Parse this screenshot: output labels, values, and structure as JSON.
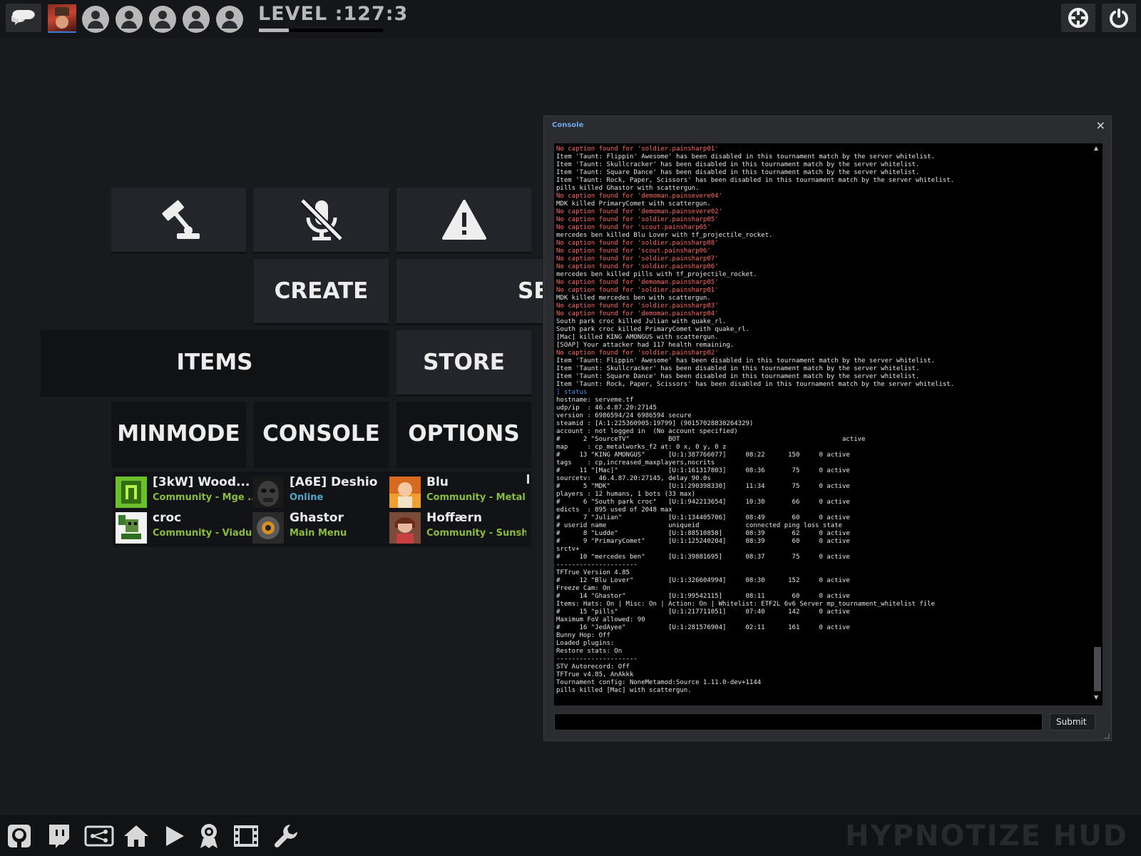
{
  "topbar": {
    "level_label": "LEVEL :127:3",
    "level_progress": 0.24,
    "party_slots": 5
  },
  "menu": {
    "create": "CREATE",
    "servers_partial": "SE",
    "items": "ITEMS",
    "store": "STORE",
    "minmode": "MINMODE",
    "console": "CONSOLE",
    "options": "OPTIONS",
    "icons": [
      "gavel-icon",
      "mic-off-icon",
      "warning-icon"
    ]
  },
  "friends": [
    {
      "name": "[3kW] Wood...",
      "status": "Community - Mge ...",
      "status_type": "community",
      "avatar": "green-block-avatar"
    },
    {
      "name": "[A6E] Deshio",
      "status": "Online",
      "status_type": "online",
      "avatar": "masked-avatar"
    },
    {
      "name": "Blu",
      "status": "Community - Metal...",
      "status_type": "community",
      "avatar": "fire-avatar"
    },
    {
      "name": "croc",
      "status": "Community - Viaduct",
      "status_type": "community",
      "avatar": "pixel-avatar"
    },
    {
      "name": "Ghastor",
      "status": "Main Menu",
      "status_type": "menu",
      "avatar": "robot-avatar"
    },
    {
      "name": "Hoffærn",
      "status": "Community - Sunsh...",
      "status_type": "community",
      "avatar": "girl-avatar"
    }
  ],
  "console": {
    "title": "Console",
    "close": "×",
    "submit": "Submit",
    "input_value": "",
    "lines": [
      {
        "t": "No caption found for 'soldier.painsharp01'",
        "c": "red"
      },
      {
        "t": "Item 'Taunt: Flippin' Awesome' has been disabled in this tournament match by the server whitelist.",
        "c": ""
      },
      {
        "t": "Item 'Taunt: Skullcracker' has been disabled in this tournament match by the server whitelist.",
        "c": ""
      },
      {
        "t": "Item 'Taunt: Square Dance' has been disabled in this tournament match by the server whitelist.",
        "c": ""
      },
      {
        "t": "Item 'Taunt: Rock, Paper, Scissors' has been disabled in this tournament match by the server whitelist.",
        "c": ""
      },
      {
        "t": "pills killed Ghastor with scattergun.",
        "c": ""
      },
      {
        "t": "No caption found for 'demoman.painsevere04'",
        "c": "red"
      },
      {
        "t": "MDK killed PrimaryComet with scattergun.",
        "c": ""
      },
      {
        "t": "No caption found for 'demoman.painsevere02'",
        "c": "red"
      },
      {
        "t": "No caption found for 'soldier.painsharp05'",
        "c": "red"
      },
      {
        "t": "No caption found for 'scout.painsharp05'",
        "c": "red"
      },
      {
        "t": "mercedes ben killed Blu Lover with tf_projectile_rocket.",
        "c": ""
      },
      {
        "t": "No caption found for 'soldier.painsharp08'",
        "c": "red"
      },
      {
        "t": "No caption found for 'scout.painsharp06'",
        "c": "red"
      },
      {
        "t": "No caption found for 'soldier.painsharp07'",
        "c": "red"
      },
      {
        "t": "No caption found for 'soldier.painsharp06'",
        "c": "red"
      },
      {
        "t": "mercedes ben killed pills with tf_projectile_rocket.",
        "c": ""
      },
      {
        "t": "No caption found for 'demoman.painsharp05'",
        "c": "red"
      },
      {
        "t": "No caption found for 'soldier.painsharp01'",
        "c": "red"
      },
      {
        "t": "MDK killed mercedes ben with scattergun.",
        "c": ""
      },
      {
        "t": "No caption found for 'soldier.painsharp03'",
        "c": "red"
      },
      {
        "t": "No caption found for 'demoman.painsharp04'",
        "c": "red"
      },
      {
        "t": "South park croc killed Julian with quake_rl.",
        "c": ""
      },
      {
        "t": "South park croc killed PrimaryComet with quake_rl.",
        "c": ""
      },
      {
        "t": "[Mac] killed KING AMONGUS with scattergun.",
        "c": ""
      },
      {
        "t": "[SOAP] Your attacker had 117 health remaining.",
        "c": ""
      },
      {
        "t": "No caption found for 'soldier.painsharp02'",
        "c": "red"
      },
      {
        "t": "Item 'Taunt: Flippin' Awesome' has been disabled in this tournament match by the server whitelist.",
        "c": ""
      },
      {
        "t": "Item 'Taunt: Skullcracker' has been disabled in this tournament match by the server whitelist.",
        "c": ""
      },
      {
        "t": "Item 'Taunt: Square Dance' has been disabled in this tournament match by the server whitelist.",
        "c": ""
      },
      {
        "t": "Item 'Taunt: Rock, Paper, Scissors' has been disabled in this tournament match by the server whitelist.",
        "c": ""
      },
      {
        "t": "] status",
        "c": "blue"
      },
      {
        "t": "hostname: serveme.tf",
        "c": ""
      },
      {
        "t": "udp/ip  : 46.4.87.20:27145",
        "c": ""
      },
      {
        "t": "version : 6986594/24 6986594 secure",
        "c": ""
      },
      {
        "t": "steamid : [A:1:225360905:19799] (90157028830264329)",
        "c": ""
      },
      {
        "t": "account : not logged in  (No account specified)",
        "c": ""
      },
      {
        "t": "#      2 \"SourceTV\"          BOT                                          active",
        "c": ""
      },
      {
        "t": "map     : cp_metalworks_f2 at: 0 x, 0 y, 0 z",
        "c": ""
      },
      {
        "t": "#     13 \"KING AMONGUS\"      [U:1:387766077]     08:22      150     0 active",
        "c": ""
      },
      {
        "t": "tags    : cp,increased_maxplayers,nocrits",
        "c": ""
      },
      {
        "t": "#     11 \"[Mac]\"             [U:1:161317803]     08:36       75     0 active",
        "c": ""
      },
      {
        "t": "sourcetv:  46.4.87.20:27145, delay 90.0s",
        "c": ""
      },
      {
        "t": "#      5 \"MDK\"               [U:1:290398330]     11:34       75     0 active",
        "c": ""
      },
      {
        "t": "players : 12 humans, 1 bots (33 max)",
        "c": ""
      },
      {
        "t": "#      6 \"South park croc\"   [U:1:942213654]     10:30       66     0 active",
        "c": ""
      },
      {
        "t": "edicts  : 895 used of 2048 max",
        "c": ""
      },
      {
        "t": "#      7 \"Julian\"            [U:1:134405706]     08:49       60     0 active",
        "c": ""
      },
      {
        "t": "# userid name                uniqueid            connected ping loss state",
        "c": ""
      },
      {
        "t": "#      8 \"Ludde\"             [U:1:88510858]      08:39       62     0 active",
        "c": ""
      },
      {
        "t": "#      9 \"PrimaryComet\"      [U:1:125240204]     08:39       60     0 active",
        "c": ""
      },
      {
        "t": "srctv+",
        "c": ""
      },
      {
        "t": "#     10 \"mercedes ben\"      [U:1:39881695]      08:37       75     0 active",
        "c": ""
      },
      {
        "t": "---------------------",
        "c": ""
      },
      {
        "t": "TFTrue Version 4.85",
        "c": ""
      },
      {
        "t": "#     12 \"Blu Lover\"         [U:1:326604994]     08:30      152     0 active",
        "c": ""
      },
      {
        "t": "Freeze Cam: On",
        "c": ""
      },
      {
        "t": "#     14 \"Ghastor\"           [U:1:99542115]      08:11       60     0 active",
        "c": ""
      },
      {
        "t": "Items: Hats: On | Misc: On | Action: On | Whitelist: ETF2L 6v6 Server mp_tournament_whitelist file",
        "c": ""
      },
      {
        "t": "#     15 \"pills\"             [U:1:217711051]     07:40      142     0 active",
        "c": ""
      },
      {
        "t": "Maximum FoV allowed: 90",
        "c": ""
      },
      {
        "t": "#     16 \"JedAyee\"           [U:1:281576904]     02:11      161     0 active",
        "c": ""
      },
      {
        "t": "Bunny Hop: Off",
        "c": ""
      },
      {
        "t": "Loaded plugins:",
        "c": ""
      },
      {
        "t": "Restore stats: On",
        "c": ""
      },
      {
        "t": "---------------------",
        "c": ""
      },
      {
        "t": "STV Autorecord: Off",
        "c": ""
      },
      {
        "t": "TFTrue v4.85, AnAkkk",
        "c": ""
      },
      {
        "t": "Tournament config: NoneMetamod:Source 1.11.0-dev+1144",
        "c": ""
      },
      {
        "t": "pills killed [Mac] with scattergun.",
        "c": ""
      }
    ]
  },
  "bottombar": {
    "icons": [
      "github-icon",
      "twitch-icon",
      "server-browser-icon",
      "home-icon",
      "play-icon",
      "achievement-icon",
      "replay-icon",
      "wrench-icon"
    ],
    "brand": "HYPNOTIZE HUD"
  },
  "colors": {
    "background": "#181a1e",
    "tile": "#23252a",
    "console_red": "#ff6a5e",
    "console_blue": "#4b8df0",
    "friend_community": "#8cbc3f",
    "friend_online": "#56a6c9"
  }
}
